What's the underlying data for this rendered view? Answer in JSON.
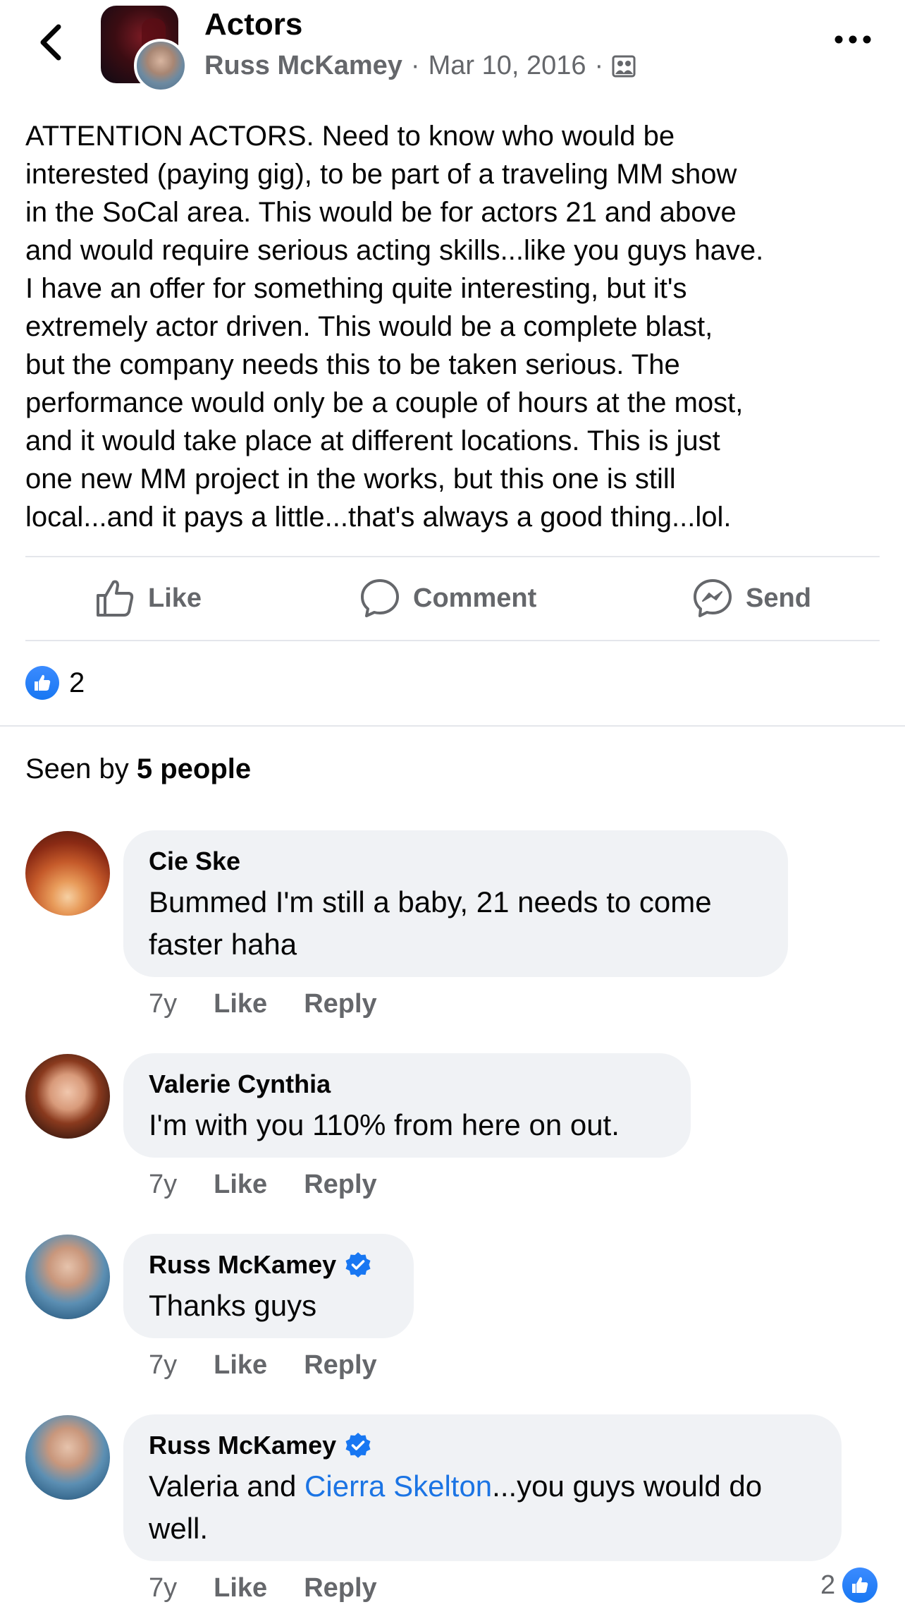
{
  "header": {
    "group_title": "Actors",
    "author": "Russ McKamey",
    "date": "Mar 10, 2016",
    "separator": "·",
    "audience_icon": "group-members-icon",
    "back_icon": "chevron-left-icon",
    "more_icon": "ellipsis-icon"
  },
  "post": {
    "body": "ATTENTION ACTORS.  Need to know who would be\ninterested (paying gig), to be part of a traveling MM show\nin the SoCal area. This would be for actors 21 and above\nand would require serious acting skills...like you guys have.\nI have an offer for something quite interesting, but it's\nextremely actor driven. This would be a complete blast,\nbut the company needs this to be taken serious. The\nperformance would only be a couple of hours at the most,\nand it would take place at different locations. This is just\none new MM project in the works, but this one is still\nlocal...and it pays a little...that's always a good thing...lol."
  },
  "actions": {
    "like_label": "Like",
    "comment_label": "Comment",
    "send_label": "Send"
  },
  "reactions": {
    "count": "2"
  },
  "seen": {
    "prefix": "Seen by ",
    "count_text": "5 people"
  },
  "comments": [
    {
      "name": "Cie Ske",
      "line1": "Bummed I'm still a baby, 21 needs to come",
      "line2": "faster haha",
      "time": "7y",
      "like": "Like",
      "reply": "Reply"
    },
    {
      "name": "Valerie Cynthia",
      "line1": "I'm with you 110% from here on out.",
      "time": "7y",
      "like": "Like",
      "reply": "Reply"
    },
    {
      "name": "Russ McKamey",
      "line1": "Thanks guys",
      "time": "7y",
      "like": "Like",
      "reply": "Reply"
    },
    {
      "name": "Russ McKamey",
      "text_before": "Valeria and ",
      "mention": "Cierra Skelton",
      "text_after": "...you guys would do",
      "line2": "well.",
      "time": "7y",
      "like": "Like",
      "reply": "Reply",
      "reaction_count": "2"
    }
  ],
  "colors": {
    "accent": "#1877f2",
    "mention": "#1b74e4",
    "secondary_text": "#65676b",
    "bubble": "#f0f2f5"
  }
}
